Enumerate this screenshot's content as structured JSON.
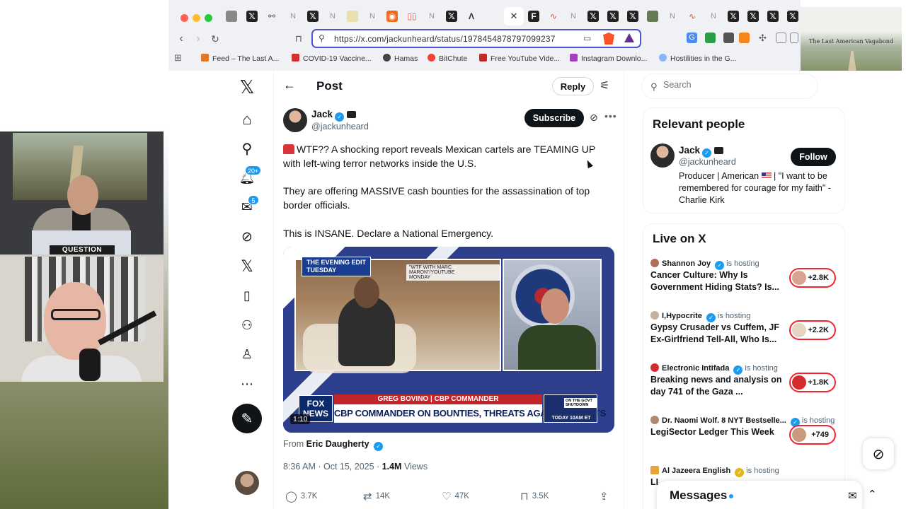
{
  "overlay": {
    "question_label": "QUESTION",
    "thumbnail_title": "The Last American Vagabond"
  },
  "browser": {
    "url": "https://x.com/jackunheard/status/1978454878797099237",
    "bookmarks": [
      {
        "label": "Feed – The Last A...",
        "color": "#e0772a"
      },
      {
        "label": "COVID-19 Vaccine...",
        "color": "#d43030"
      },
      {
        "label": "Hamas",
        "color": "#444444"
      },
      {
        "label": "BitChute",
        "color": "#ef4136"
      },
      {
        "label": "Free YouTube Vide...",
        "color": "#c62828"
      },
      {
        "label": "Instagram Downlo...",
        "color": "#a43ec4"
      },
      {
        "label": "Hostilities in the G...",
        "color": "#8ab4f8"
      }
    ]
  },
  "nav": {
    "notifications_badge": "20+",
    "messages_badge": "5"
  },
  "post": {
    "header_title": "Post",
    "reply_label": "Reply",
    "author_name": "Jack",
    "author_handle": "@jackunheard",
    "subscribe_label": "Subscribe",
    "text_line1": "WTF?? A shocking report reveals Mexican cartels are TEAMING UP",
    "text_line2": "with left-wing terror networks inside the U.S.",
    "text_line3": "They are offering MASSIVE cash bounties for the assassination of top",
    "text_line4": "border officials.",
    "text_line5": "This is INSANE. Declare a National Emergency.",
    "media": {
      "evening_edit": "THE EVENING EDIT",
      "evening_day": "TUESDAY",
      "source_label": "\"WTF WITH MARC MARON\"/YOUTUBE",
      "source_day": "MONDAY",
      "fox_line1": "FOX",
      "fox_line2": "NEWS",
      "red_bar": "GREG BOVINO | CBP COMMANDER",
      "headline": "CBP COMMANDER ON BOUNTIES, THREATS AGAINST AGENTS",
      "promo_badge": "ON THE GOVT SHUTDOWN",
      "promo_text": "TODAY 10AM ET",
      "duration": "1:10"
    },
    "from_prefix": "From",
    "from_name": "Eric Daugherty",
    "timestamp": "8:36 AM · Oct 15, 2025 ·",
    "views_count": "1.4M",
    "views_label": "Views",
    "replies": "3.7K",
    "reposts": "14K",
    "likes": "47K",
    "bookmarks": "3.5K"
  },
  "sidebar": {
    "search_placeholder": "Search",
    "relevant_title": "Relevant people",
    "relevant_name": "Jack",
    "relevant_handle": "@jackunheard",
    "follow_label": "Follow",
    "bio_prefix": "Producer | American",
    "bio_suffix": "| \"I want to be remembered for courage for my faith\" - Charlie Kirk",
    "live_title": "Live on X",
    "hosting_label": "is hosting",
    "live_items": [
      {
        "host": "Shannon Joy",
        "title": "Cancer Culture: Why Is Government Hiding Stats? Is...",
        "count": "+2.8K",
        "host_color": "#b26c5a",
        "av_color": "#d9a48f",
        "gold": false
      },
      {
        "host": "I,Hypocrite",
        "title": "Gypsy Crusader vs Cuffem, JF Ex-Girlfriend Tell-All, Who Is...",
        "count": "+2.2K",
        "host_color": "#c9b09a",
        "av_color": "#e5d5c0",
        "gold": false
      },
      {
        "host": "Electronic Intifada",
        "title": "Breaking news and analysis on day 741 of the Gaza ...",
        "count": "+1.8K",
        "host_color": "#d42b2b",
        "av_color": "#d42b2b",
        "gold": false
      },
      {
        "host": "Dr. Naomi Wolf. 8 NYT Bestselle...",
        "title": "LegiSector Ledger This Week",
        "count": "+749",
        "host_color": "#b08a70",
        "av_color": "#c99b7c",
        "gold": false
      },
      {
        "host": "Al Jazeera English",
        "title": "LI",
        "count": "",
        "host_color": "#e8a33a",
        "av_color": "#e8a33a",
        "gold": true
      }
    ],
    "messages_title": "Messages"
  }
}
